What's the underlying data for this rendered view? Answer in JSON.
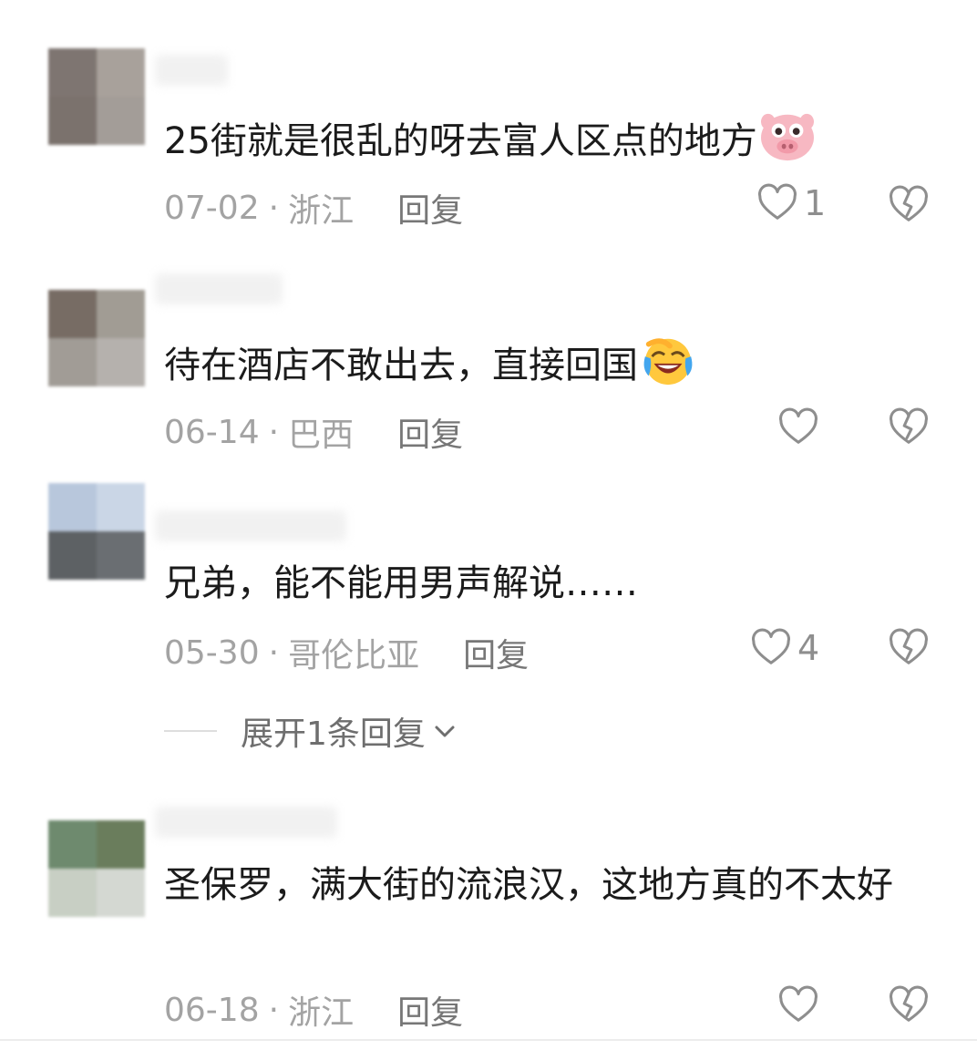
{
  "reply_label": "回复",
  "dot": "·",
  "comments": [
    {
      "text": "25街就是很乱的呀去富人区点的地方",
      "emoji": "pig-face-emoji",
      "date": "07-02",
      "location": "浙江",
      "likes": "1",
      "avatar_colors": [
        "#7e7571",
        "#a8a19b",
        "#7b726d",
        "#a39d98"
      ]
    },
    {
      "text": "待在酒店不敢出去，直接回国",
      "emoji": "crying-laughing-emoji",
      "date": "06-14",
      "location": "巴西",
      "likes": "",
      "avatar_colors": [
        "#776c64",
        "#a19c94",
        "#a19c96",
        "#b5b1ad"
      ]
    },
    {
      "text": "兄弟，能不能用男声解说……",
      "date": "05-30",
      "location": "哥伦比亚",
      "likes": "4",
      "avatar_colors": [
        "#b8c7dc",
        "#cad6e6",
        "#5d6164",
        "#6a6e72"
      ],
      "expand_label": "展开1条回复"
    },
    {
      "text": "圣保罗，满大街的流浪汉，这地方真的不太好",
      "date": "06-18",
      "location": "浙江",
      "likes": "",
      "avatar_colors": [
        "#6e8a6e",
        "#6a7d5c",
        "#c8cfc4",
        "#d4d8d2"
      ]
    }
  ],
  "colors": {
    "text": "#1b1b1b",
    "meta": "#a3a3a3",
    "reply": "#777777",
    "icon": "#8e8e8e"
  }
}
